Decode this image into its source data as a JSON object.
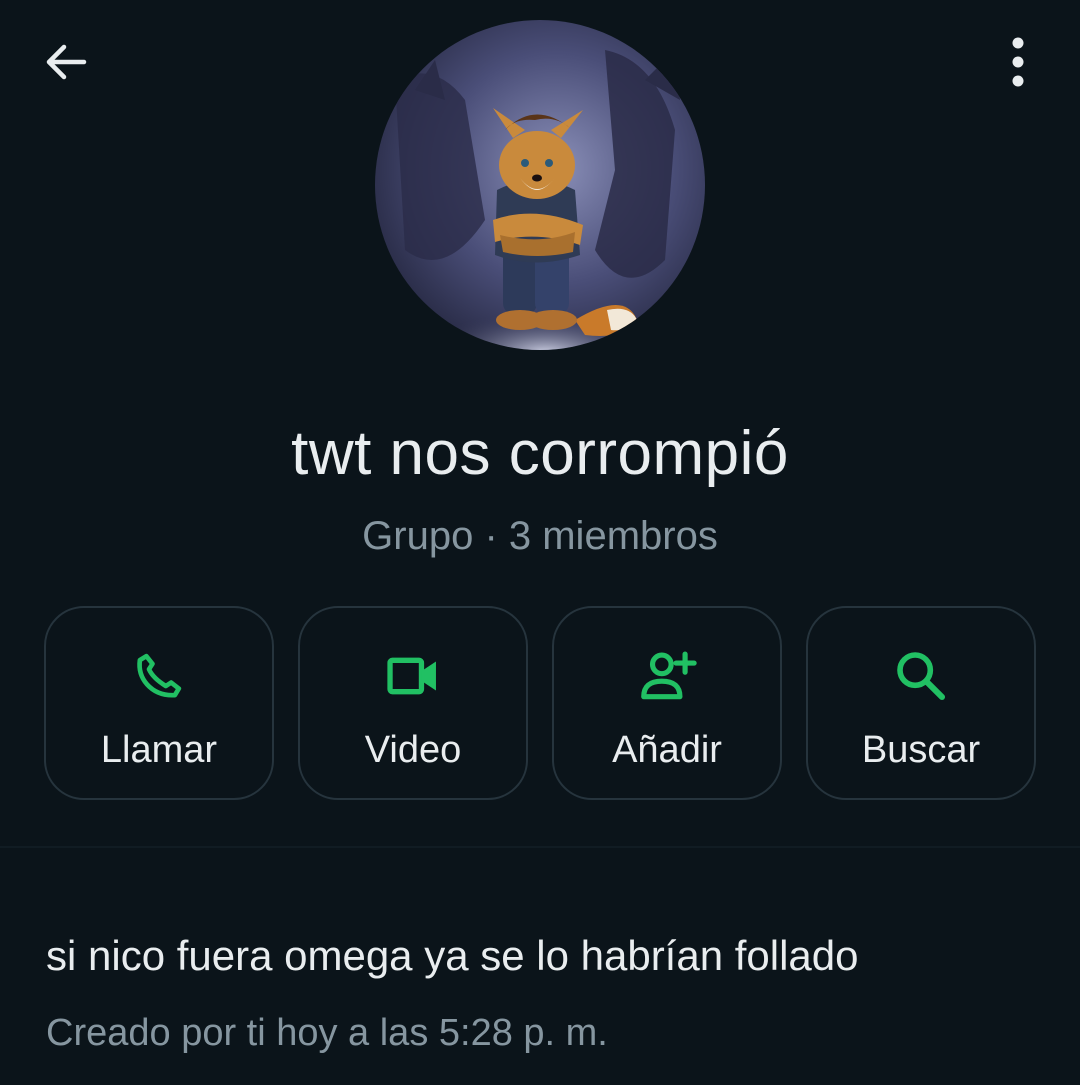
{
  "header": {
    "back_icon": "arrow-left-icon",
    "menu_icon": "more-vertical-icon"
  },
  "group": {
    "name": "twt nos corrompió",
    "meta": "Grupo · 3 miembros",
    "avatar_icon": "group-avatar-image"
  },
  "actions": [
    {
      "label": "Llamar",
      "icon": "phone-icon"
    },
    {
      "label": "Video",
      "icon": "video-camera-icon"
    },
    {
      "label": "Añadir",
      "icon": "add-person-icon"
    },
    {
      "label": "Buscar",
      "icon": "search-icon"
    }
  ],
  "description": {
    "text": "si nico fuera omega ya se lo habrían follado",
    "created": "Creado por ti hoy a las 5:28 p. m."
  },
  "colors": {
    "background": "#0b141a",
    "accent": "#21c063",
    "primary_text": "#e9edef",
    "secondary_text": "#8696a0",
    "button_border": "#26343d"
  }
}
